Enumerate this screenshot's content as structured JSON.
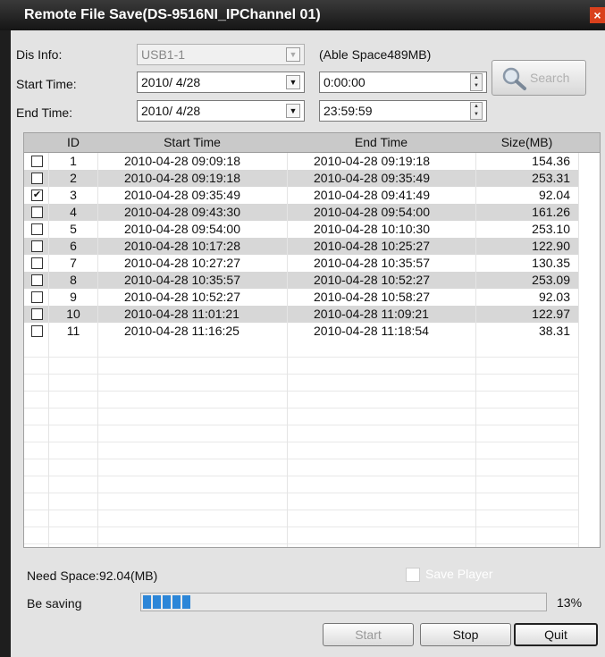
{
  "window": {
    "title": "Remote File Save(DS-9516NI_IPChannel 01)",
    "close_glyph": "×"
  },
  "dis_info": {
    "label": "Dis Info:",
    "value": "USB1-1",
    "able_space": "(Able Space489MB)"
  },
  "start_time": {
    "label": "Start Time:",
    "date": "2010/  4/28",
    "time": "0:00:00"
  },
  "end_time": {
    "label": "End Time:",
    "date": "2010/  4/28",
    "time": "23:59:59"
  },
  "search": {
    "label": "Search"
  },
  "table": {
    "headers": {
      "id": "ID",
      "start": "Start Time",
      "end": "End Time",
      "size": "Size(MB)"
    },
    "rows": [
      {
        "checked": false,
        "id": "1",
        "start": "2010-04-28  09:09:18",
        "end": "2010-04-28  09:19:18",
        "size": "154.36"
      },
      {
        "checked": false,
        "id": "2",
        "start": "2010-04-28  09:19:18",
        "end": "2010-04-28  09:35:49",
        "size": "253.31"
      },
      {
        "checked": true,
        "id": "3",
        "start": "2010-04-28  09:35:49",
        "end": "2010-04-28  09:41:49",
        "size": "92.04"
      },
      {
        "checked": false,
        "id": "4",
        "start": "2010-04-28  09:43:30",
        "end": "2010-04-28  09:54:00",
        "size": "161.26"
      },
      {
        "checked": false,
        "id": "5",
        "start": "2010-04-28  09:54:00",
        "end": "2010-04-28  10:10:30",
        "size": "253.10"
      },
      {
        "checked": false,
        "id": "6",
        "start": "2010-04-28  10:17:28",
        "end": "2010-04-28  10:25:27",
        "size": "122.90"
      },
      {
        "checked": false,
        "id": "7",
        "start": "2010-04-28  10:27:27",
        "end": "2010-04-28  10:35:57",
        "size": "130.35"
      },
      {
        "checked": false,
        "id": "8",
        "start": "2010-04-28  10:35:57",
        "end": "2010-04-28  10:52:27",
        "size": "253.09"
      },
      {
        "checked": false,
        "id": "9",
        "start": "2010-04-28  10:52:27",
        "end": "2010-04-28  10:58:27",
        "size": "92.03"
      },
      {
        "checked": false,
        "id": "10",
        "start": "2010-04-28  11:01:21",
        "end": "2010-04-28  11:09:21",
        "size": "122.97"
      },
      {
        "checked": false,
        "id": "11",
        "start": "2010-04-28  11:16:25",
        "end": "2010-04-28  11:18:54",
        "size": "38.31"
      }
    ]
  },
  "need_space": "Need Space:92.04(MB)",
  "save_player": "Save Player",
  "saving": {
    "label": "Be saving",
    "percent_text": "13%",
    "fill_fraction": 0.13
  },
  "buttons": {
    "start": "Start",
    "stop": "Stop",
    "quit": "Quit"
  },
  "colors": {
    "progress": "#2c86d8",
    "close": "#d9401c"
  }
}
